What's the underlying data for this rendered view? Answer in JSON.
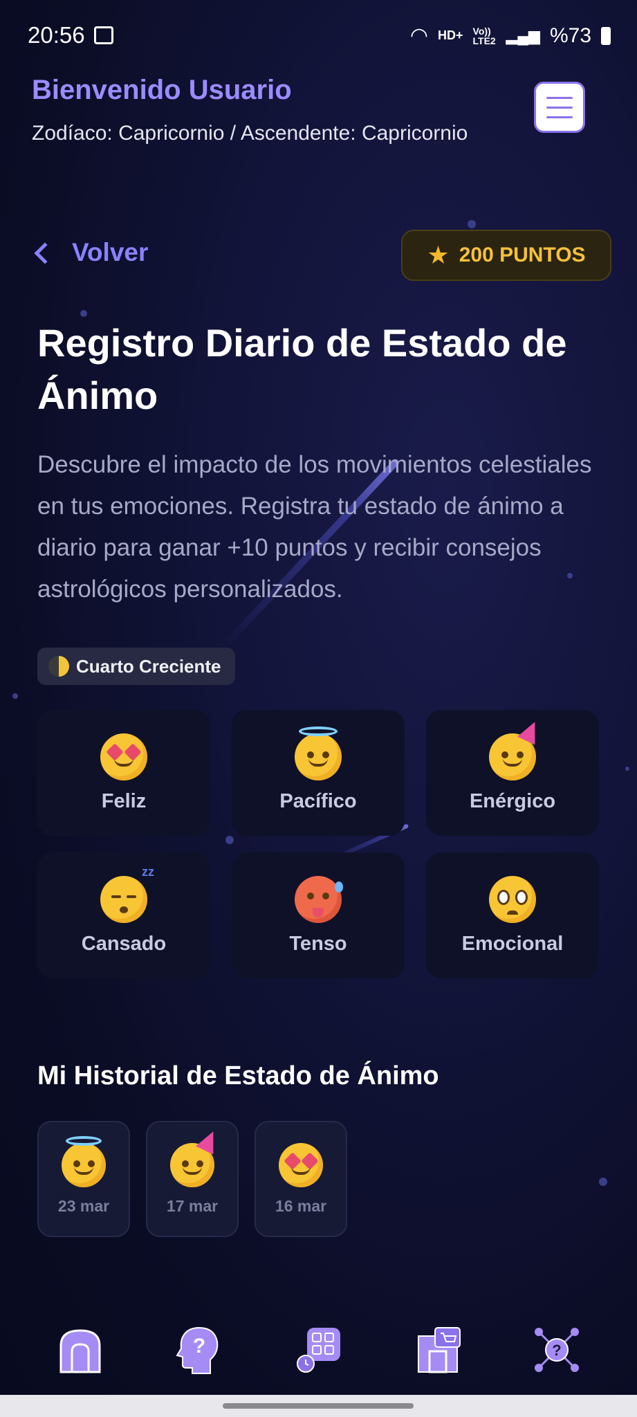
{
  "status_bar": {
    "time": "20:56",
    "network": "HD+",
    "lte": "Vo)) LTE2",
    "battery": "%73"
  },
  "header": {
    "welcome": "Bienvenido Usuario",
    "zodiac": "Zodíaco: Capricornio / Ascendente: Capricornio"
  },
  "nav_top": {
    "back_label": "Volver",
    "points_label": "200 PUNTOS"
  },
  "main": {
    "title": "Registro Diario de Estado de Ánimo",
    "description": "Descubre el impacto de los movimientos celestiales en tus emociones. Registra tu estado de ánimo a diario para ganar +10 puntos y recibir consejos astrológicos personalizados.",
    "moon_phase": "Cuarto Creciente"
  },
  "moods": [
    {
      "label": "Feliz",
      "icon": "star-struck-face-icon"
    },
    {
      "label": "Pacífico",
      "icon": "smiling-face-with-halo-icon"
    },
    {
      "label": "Enérgico",
      "icon": "partying-face-icon"
    },
    {
      "label": "Cansado",
      "icon": "sleeping-face-icon"
    },
    {
      "label": "Tenso",
      "icon": "hot-face-icon"
    },
    {
      "label": "Emocional",
      "icon": "pleading-face-icon"
    }
  ],
  "history": {
    "title": "Mi Historial de Estado de Ánimo",
    "entries": [
      {
        "date": "23 mar",
        "icon": "smiling-face-with-halo-icon"
      },
      {
        "date": "17 mar",
        "icon": "partying-face-icon"
      },
      {
        "date": "16 mar",
        "icon": "star-struck-face-icon"
      }
    ]
  },
  "bottom_nav": [
    {
      "name": "home-icon"
    },
    {
      "name": "help-head-icon"
    },
    {
      "name": "apps-grid-icon"
    },
    {
      "name": "shop-icon"
    },
    {
      "name": "network-help-icon"
    }
  ],
  "colors": {
    "accent": "#8a82ff",
    "welcome": "#9b8cff",
    "points": "#f7c13a",
    "nav_icon": "#a58cf5"
  }
}
